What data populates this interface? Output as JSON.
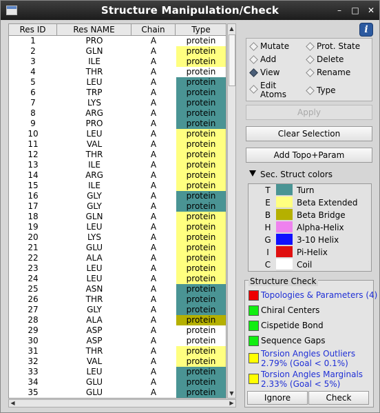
{
  "window": {
    "title": "Structure Manipulation/Check",
    "min": "–",
    "max": "□",
    "close": "✕"
  },
  "table": {
    "headers": [
      "Res ID",
      "Res NAME",
      "Chain",
      "Type"
    ],
    "rows": [
      {
        "id": "1",
        "name": "PRO",
        "chain": "A",
        "type": "protein",
        "ss": "C"
      },
      {
        "id": "2",
        "name": "GLN",
        "chain": "A",
        "type": "protein",
        "ss": "E"
      },
      {
        "id": "3",
        "name": "ILE",
        "chain": "A",
        "type": "protein",
        "ss": "E"
      },
      {
        "id": "4",
        "name": "THR",
        "chain": "A",
        "type": "protein",
        "ss": "C"
      },
      {
        "id": "5",
        "name": "LEU",
        "chain": "A",
        "type": "protein",
        "ss": "T"
      },
      {
        "id": "6",
        "name": "TRP",
        "chain": "A",
        "type": "protein",
        "ss": "T"
      },
      {
        "id": "7",
        "name": "LYS",
        "chain": "A",
        "type": "protein",
        "ss": "T"
      },
      {
        "id": "8",
        "name": "ARG",
        "chain": "A",
        "type": "protein",
        "ss": "T"
      },
      {
        "id": "9",
        "name": "PRO",
        "chain": "A",
        "type": "protein",
        "ss": "T"
      },
      {
        "id": "10",
        "name": "LEU",
        "chain": "A",
        "type": "protein",
        "ss": "E"
      },
      {
        "id": "11",
        "name": "VAL",
        "chain": "A",
        "type": "protein",
        "ss": "E"
      },
      {
        "id": "12",
        "name": "THR",
        "chain": "A",
        "type": "protein",
        "ss": "E"
      },
      {
        "id": "13",
        "name": "ILE",
        "chain": "A",
        "type": "protein",
        "ss": "E"
      },
      {
        "id": "14",
        "name": "ARG",
        "chain": "A",
        "type": "protein",
        "ss": "E"
      },
      {
        "id": "15",
        "name": "ILE",
        "chain": "A",
        "type": "protein",
        "ss": "E"
      },
      {
        "id": "16",
        "name": "GLY",
        "chain": "A",
        "type": "protein",
        "ss": "T"
      },
      {
        "id": "17",
        "name": "GLY",
        "chain": "A",
        "type": "protein",
        "ss": "T"
      },
      {
        "id": "18",
        "name": "GLN",
        "chain": "A",
        "type": "protein",
        "ss": "E"
      },
      {
        "id": "19",
        "name": "LEU",
        "chain": "A",
        "type": "protein",
        "ss": "E"
      },
      {
        "id": "20",
        "name": "LYS",
        "chain": "A",
        "type": "protein",
        "ss": "E"
      },
      {
        "id": "21",
        "name": "GLU",
        "chain": "A",
        "type": "protein",
        "ss": "E"
      },
      {
        "id": "22",
        "name": "ALA",
        "chain": "A",
        "type": "protein",
        "ss": "E"
      },
      {
        "id": "23",
        "name": "LEU",
        "chain": "A",
        "type": "protein",
        "ss": "E"
      },
      {
        "id": "24",
        "name": "LEU",
        "chain": "A",
        "type": "protein",
        "ss": "E"
      },
      {
        "id": "25",
        "name": "ASN",
        "chain": "A",
        "type": "protein",
        "ss": "T"
      },
      {
        "id": "26",
        "name": "THR",
        "chain": "A",
        "type": "protein",
        "ss": "T"
      },
      {
        "id": "27",
        "name": "GLY",
        "chain": "A",
        "type": "protein",
        "ss": "T"
      },
      {
        "id": "28",
        "name": "ALA",
        "chain": "A",
        "type": "protein",
        "ss": "B"
      },
      {
        "id": "29",
        "name": "ASP",
        "chain": "A",
        "type": "protein",
        "ss": "C"
      },
      {
        "id": "30",
        "name": "ASP",
        "chain": "A",
        "type": "protein",
        "ss": "C"
      },
      {
        "id": "31",
        "name": "THR",
        "chain": "A",
        "type": "protein",
        "ss": "E"
      },
      {
        "id": "32",
        "name": "VAL",
        "chain": "A",
        "type": "protein",
        "ss": "E"
      },
      {
        "id": "33",
        "name": "LEU",
        "chain": "A",
        "type": "protein",
        "ss": "T"
      },
      {
        "id": "34",
        "name": "GLU",
        "chain": "A",
        "type": "protein",
        "ss": "T"
      },
      {
        "id": "35",
        "name": "GLU",
        "chain": "A",
        "type": "protein",
        "ss": "T"
      }
    ]
  },
  "actions": {
    "options": [
      {
        "label": "Mutate",
        "selected": false
      },
      {
        "label": "Prot. State",
        "selected": false
      },
      {
        "label": "Add",
        "selected": false
      },
      {
        "label": "Delete",
        "selected": false
      },
      {
        "label": "View",
        "selected": true
      },
      {
        "label": "Rename",
        "selected": false
      },
      {
        "label": "Edit\nAtoms",
        "selected": false
      },
      {
        "label": "Type",
        "selected": false
      }
    ],
    "apply": "Apply",
    "clear_selection": "Clear Selection",
    "add_topo": "Add Topo+Param"
  },
  "sec_struct": {
    "title": "Sec. Struct colors",
    "items": [
      {
        "code": "T",
        "name": "Turn",
        "color": "#4a9494"
      },
      {
        "code": "E",
        "name": "Beta Extended",
        "color": "#ffff80"
      },
      {
        "code": "B",
        "name": "Beta Bridge",
        "color": "#b5b000"
      },
      {
        "code": "H",
        "name": "Alpha-Helix",
        "color": "#ee82ee"
      },
      {
        "code": "G",
        "name": "3-10 Helix",
        "color": "#1010ff"
      },
      {
        "code": "I",
        "name": "Pi-Helix",
        "color": "#e01010"
      },
      {
        "code": "C",
        "name": "Coil",
        "color": "#ffffff"
      }
    ]
  },
  "structure_check": {
    "title": "Structure Check",
    "items": [
      {
        "line1": "Topologies & Parameters (4)",
        "line2": "",
        "color": "#ee0000",
        "link": true
      },
      {
        "line1": "Chiral Centers",
        "line2": "",
        "color": "#11ee11",
        "link": false
      },
      {
        "line1": "Cispetide Bond",
        "line2": "",
        "color": "#11ee11",
        "link": false
      },
      {
        "line1": "Sequence Gaps",
        "line2": "",
        "color": "#11ee11",
        "link": false
      },
      {
        "line1": "Torsion Angles Outliers",
        "line2": "2.79% (Goal < 0.1%)",
        "color": "#ffff00",
        "link": true
      },
      {
        "line1": "Torsion Angles Marginals",
        "line2": "2.33% (Goal < 5%)",
        "color": "#ffff00",
        "link": true
      }
    ],
    "ignore": "Ignore",
    "check": "Check"
  }
}
